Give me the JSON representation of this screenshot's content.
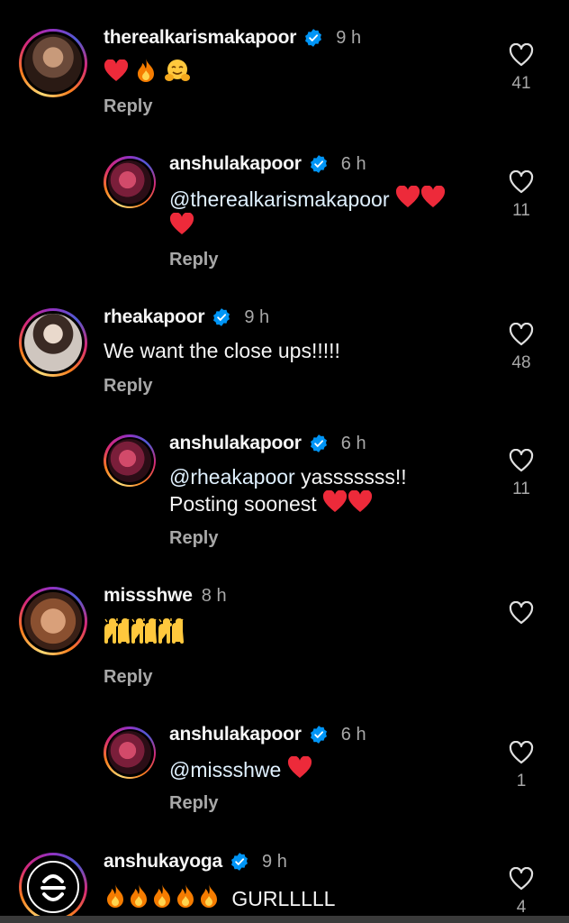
{
  "colors": {
    "background": "#000000",
    "text": "#f5f5f5",
    "muted": "#a8a8a8",
    "verified": "#0095f6",
    "heart": "#ed4956"
  },
  "comments": [
    {
      "username": "therealkarismakapoor",
      "verified": true,
      "time": "9 h",
      "text": "",
      "emojis": [
        "heart",
        "fire",
        "hug"
      ],
      "reply_label": "Reply",
      "likes": "41",
      "is_reply": false
    },
    {
      "username": "anshulakapoor",
      "verified": true,
      "time": "6 h",
      "mention": "@therealkarismakapoor",
      "text": "",
      "reply_label": "Reply",
      "likes": "11",
      "is_reply": true
    },
    {
      "username": "rheakapoor",
      "verified": true,
      "time": "9 h",
      "text": "We want the close ups!!!!!",
      "reply_label": "Reply",
      "likes": "48",
      "is_reply": false
    },
    {
      "username": "anshulakapoor",
      "verified": true,
      "time": "6 h",
      "mention": "@rheakapoor",
      "text": " yasssssss!!",
      "text2": "Posting soonest",
      "reply_label": "Reply",
      "likes": "11",
      "is_reply": true
    },
    {
      "username": "missshwe",
      "verified": false,
      "time": "8 h",
      "text": "",
      "emojis": [
        "raised-hands",
        "raised-hands",
        "raised-hands"
      ],
      "reply_label": "Reply",
      "likes": "",
      "is_reply": false
    },
    {
      "username": "anshulakapoor",
      "verified": true,
      "time": "6 h",
      "mention": "@missshwe",
      "text": "",
      "reply_label": "Reply",
      "likes": "1",
      "is_reply": true
    },
    {
      "username": "anshukayoga",
      "verified": true,
      "time": "9 h",
      "text": "GURLLLLL",
      "emojis": [
        "fire",
        "fire",
        "fire",
        "fire",
        "fire"
      ],
      "reply_label": "",
      "likes": "4",
      "is_reply": false
    }
  ]
}
